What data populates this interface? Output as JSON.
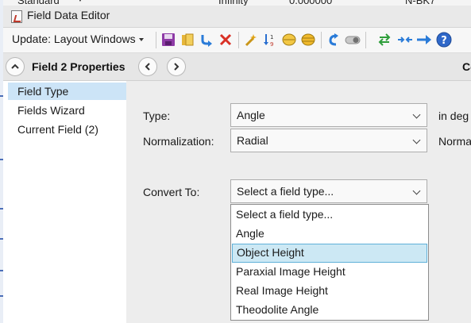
{
  "background": {
    "top_texts": [
      "Standard",
      "Infinity",
      "0.000000",
      "N-BK7"
    ]
  },
  "window": {
    "title": "Field Data Editor"
  },
  "toolbar": {
    "update_label": "Update: Layout Windows"
  },
  "section": {
    "title": "Field  2 Properties",
    "right_cut": "Co"
  },
  "nav": {
    "items": [
      {
        "label": "Field Type",
        "selected": true
      },
      {
        "label": "Fields Wizard",
        "selected": false
      },
      {
        "label": "Current Field (2)",
        "selected": false
      }
    ]
  },
  "form": {
    "type_label": "Type:",
    "type_value": "Angle",
    "type_suffix": "in deg",
    "norm_label": "Normalization:",
    "norm_value": "Radial",
    "norm_suffix": "Norma",
    "convert_label": "Convert To:",
    "convert_value": "Select a field type..."
  },
  "dropdown": {
    "options": [
      {
        "label": "Select a field type...",
        "highlighted": false
      },
      {
        "label": "Angle",
        "highlighted": false
      },
      {
        "label": "Object Height",
        "highlighted": true
      },
      {
        "label": "Paraxial Image Height",
        "highlighted": false
      },
      {
        "label": "Real Image Height",
        "highlighted": false
      },
      {
        "label": "Theodolite Angle",
        "highlighted": false
      }
    ]
  },
  "colors": {
    "nav_selected": "#cce4f7",
    "option_highlight": "#cce8f4",
    "panel_bg": "#ededed"
  }
}
